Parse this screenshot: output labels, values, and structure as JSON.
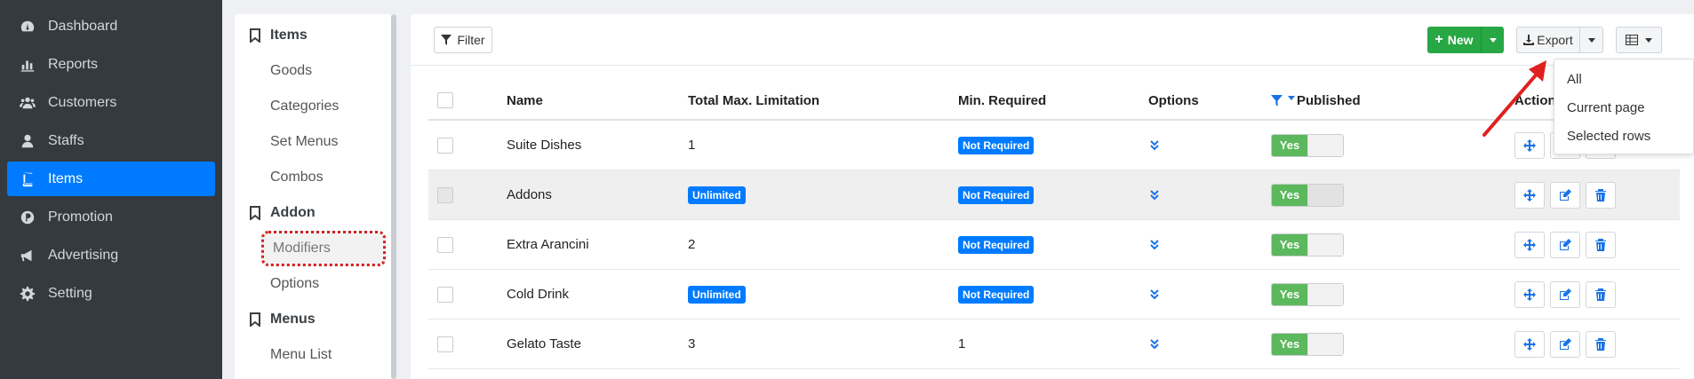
{
  "sidebar": {
    "items": [
      {
        "label": "Dashboard",
        "icon": "dashboard-icon"
      },
      {
        "label": "Reports",
        "icon": "bar-chart-icon"
      },
      {
        "label": "Customers",
        "icon": "users-icon"
      },
      {
        "label": "Staffs",
        "icon": "staff-icon"
      },
      {
        "label": "Items",
        "icon": "book-icon"
      },
      {
        "label": "Promotion",
        "icon": "promotion-icon"
      },
      {
        "label": "Advertising",
        "icon": "megaphone-icon"
      },
      {
        "label": "Setting",
        "icon": "gear-icon"
      }
    ],
    "active_color": "#007bff"
  },
  "subnav": {
    "items_heading": "Items",
    "items": [
      "Goods",
      "Categories",
      "Set Menus",
      "Combos"
    ],
    "addon_heading": "Addon",
    "addon": [
      "Modifiers",
      "Options"
    ],
    "menus_heading": "Menus",
    "menus": [
      "Menu List"
    ]
  },
  "toolbar": {
    "filter_label": "Filter",
    "new_label": "New",
    "export_label": "Export"
  },
  "table": {
    "headers": {
      "name": "Name",
      "total_max": "Total Max. Limitation",
      "min_required": "Min. Required",
      "options": "Options",
      "published": "Published",
      "action": "Action"
    },
    "rows": [
      {
        "name": "Suite Dishes",
        "total_max": "1",
        "min_required": "Not Required",
        "published": "Yes"
      },
      {
        "name": "Addons",
        "total_max": "Unlimited",
        "min_required": "Not Required",
        "published": "Yes"
      },
      {
        "name": "Extra Arancini",
        "total_max": "2",
        "min_required": "Not Required",
        "published": "Yes"
      },
      {
        "name": "Cold Drink",
        "total_max": "Unlimited",
        "min_required": "Not Required",
        "published": "Yes"
      },
      {
        "name": "Gelato Taste",
        "total_max": "3",
        "min_required": "1",
        "published": "Yes"
      }
    ]
  },
  "export_menu": {
    "items": [
      "All",
      "Current page",
      "Selected rows"
    ]
  }
}
